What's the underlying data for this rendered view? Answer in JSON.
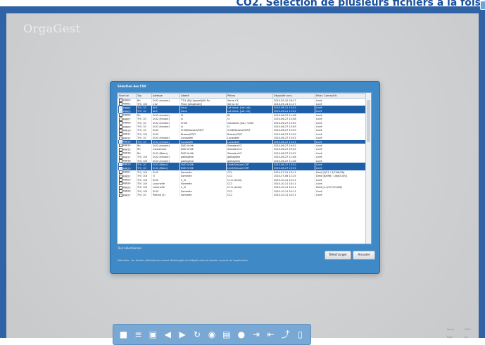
{
  "caption": "CO2. Sélection de plusieurs fichiers à la fois",
  "app": {
    "logo": "OrgaGest"
  },
  "dialog": {
    "title": "Sélection des CSV",
    "columns": [
      "Num lot",
      "Typ",
      "Adresse",
      "Libellé",
      "Pièces",
      "Dispositif conc.",
      "Mise / Cornay/Fic"
    ],
    "rows": [
      {
        "selected": false,
        "cells": [
          "46603",
          "Rh",
          "D.02 (envoie)",
          "TT-5 (M) [Appart]/00 Pu",
          "Servo CS",
          "2010-05-10 16:17",
          "Livré"
        ]
      },
      {
        "selected": false,
        "cells": [
          "46601",
          "TH / 10t",
          "C12",
          "Prod. [stagevale]",
          "Servo 10",
          "2010-05-14 11:17",
          "Livré"
        ]
      },
      {
        "selected": true,
        "cells": [
          "46604",
          "TH / 10",
          "ALS",
          "Sous",
          "Lot trans. [Lot Lrd]",
          "2010-06-21 13:42",
          "Livré"
        ]
      },
      {
        "selected": true,
        "cells": [
          "46605",
          "TH / 10",
          "ALS",
          "Sous",
          "Lot trans. [Lot Lrd]",
          "2010-06-21 13:42",
          "Livré"
        ]
      },
      {
        "selected": false,
        "cells": [
          "46606",
          "Rh",
          "D.02 (envoie)",
          "Vi",
          "Rt",
          "2010-06-27 11:48",
          "Livré"
        ]
      },
      {
        "selected": false,
        "cells": [
          "46607",
          "TH / 10",
          "D.02 (envoie)",
          "vi",
          "Ci",
          "2010-06-27 13:48",
          "Livré"
        ]
      },
      {
        "selected": false,
        "cells": [
          "46608",
          "TH / 10",
          "D.02 (envoie)",
          "Vrillé",
          "Industriel (nat.) Vrillé",
          "2010-06-27 13:49",
          "Livré"
        ]
      },
      {
        "selected": false,
        "cells": [
          "46609",
          "TH / 10",
          "D.02 (envoie)",
          "vi",
          "Ci",
          "2010-06-27 13:49",
          "Livré"
        ]
      },
      {
        "selected": false,
        "cells": [
          "46610",
          "TH / 10",
          "D.02",
          "Vrillé/Sessuel/CR/T",
          "Vrillé/Sessuel/CR/T",
          "2010-06-27 13:49",
          "Livré"
        ]
      },
      {
        "selected": false,
        "cells": [
          "46611",
          "TH / 10t",
          "D.02",
          "Brosse/CR/T",
          "Brosse/CR/T",
          "2010-06-27 13:49",
          "Livré"
        ]
      },
      {
        "selected": false,
        "cells": [
          "46612",
          "TH / 10",
          "D.02 (envoie)",
          "Lucasdelli",
          "Lucasdelli",
          "2010-06-27 13:52",
          "Livré"
        ]
      },
      {
        "selected": true,
        "cells": [
          "46613",
          "TH / 10",
          "D.02 (envoie)",
          "Lucasdelli",
          "Lucasdelli",
          "2010-06-27 13:52",
          "Livré"
        ]
      },
      {
        "selected": false,
        "cells": [
          "46614",
          "Rh",
          "D.02 (envoie)",
          "DVD Vrillé",
          "Standard CI",
          "2010-06-27 19:52",
          "Livré"
        ]
      },
      {
        "selected": false,
        "cells": [
          "46615",
          "Rh",
          "Couverture",
          "DVD Vrillé",
          "Standard CI",
          "2010-06-27 19:52",
          "Livré"
        ]
      },
      {
        "selected": false,
        "cells": [
          "46616",
          "Rh",
          "D.02 (Blanc)",
          "DVD Vrillé",
          "Standard CI",
          "2010-06-27 19:52",
          "Livré"
        ]
      },
      {
        "selected": false,
        "cells": [
          "46617",
          "TH / 10t",
          "D.02 (envoie)",
          "galliagène",
          "galliagène",
          "2010-06-27 11:48",
          "Livré"
        ]
      },
      {
        "selected": false,
        "cells": [
          "46618",
          "TH / 10t",
          "D.02 (envoie)",
          "galliagène",
          "galliagène",
          "2010-06-27 11:48",
          "Livré"
        ]
      },
      {
        "selected": true,
        "cells": [
          "46619",
          "TH / 10",
          "D.02 (Blanc)",
          "DVD Vrillé",
          "Livré/Sessuel CRT",
          "2010-06-27 13:52",
          "Livré"
        ]
      },
      {
        "selected": true,
        "cells": [
          "46620",
          "TH / 10",
          "D.02 (Blanc)",
          "DVD Vrillé",
          "Livré/Sessuel CRT",
          "2010-06-27 13:52",
          "Livré"
        ]
      },
      {
        "selected": false,
        "cells": [
          "46621",
          "TH / 10t",
          "D.02",
          "Sommée",
          "CC1",
          "2010-07-01 15:11",
          "Dmd [S/21 / 3/7/96/36]"
        ]
      },
      {
        "selected": false,
        "cells": [
          "46622",
          "TH / 10t",
          "Ti",
          "Sommée",
          "CC1",
          "2010-07-06 11:15",
          "Dmd [B/896 / 1/6/6/1/00]"
        ]
      },
      {
        "selected": false,
        "cells": [
          "46623",
          "TH / 10t",
          "D.02",
          "L_Ci",
          "Ci Ci (aerie)",
          "2010-10-11 10:11",
          "Livré"
        ]
      },
      {
        "selected": false,
        "cells": [
          "46624",
          "TH / 10t",
          "Luxunelle",
          "Sommée",
          "CC1",
          "2010-10-11 10:11",
          "Livré"
        ]
      },
      {
        "selected": false,
        "cells": [
          "46625",
          "TH / 10t",
          "Luxunelle",
          "L_Ci",
          "Ci Ci (aerie)",
          "2010-10-11 10:11",
          "Dmd [L-1/57/7/Ci/08]"
        ]
      },
      {
        "selected": false,
        "cells": [
          "46626",
          "TH / 10t",
          "D.02",
          "Sommée",
          "CC1",
          "2010-10-11 10:11",
          "Livré"
        ]
      },
      {
        "selected": false,
        "cells": [
          "46627",
          "TH / 10",
          "Platine (2)",
          "Sommée",
          "CC1",
          "2010-10-11 10:11",
          "Livré"
        ]
      }
    ],
    "select_all_label": "Tout sélectionner",
    "note": "Attention : les fichiers sélectionnés seront téléchargés et intégrés dans le dossier courant de l'application.",
    "buttons": {
      "download": "Télécharger",
      "cancel": "Annuler"
    }
  },
  "toolbar": {
    "icons": [
      "folder-icon",
      "print-icon",
      "copy-icon",
      "back-icon",
      "forward-icon",
      "refresh-icon",
      "eye-icon",
      "save-icon",
      "users-icon",
      "export-icon",
      "import-icon",
      "share-icon",
      "trash-icon"
    ]
  },
  "corner": {
    "zoom_label": "Zoom",
    "zoom_value": "100%",
    "page_label": "Page",
    "page_value": "1/1"
  }
}
